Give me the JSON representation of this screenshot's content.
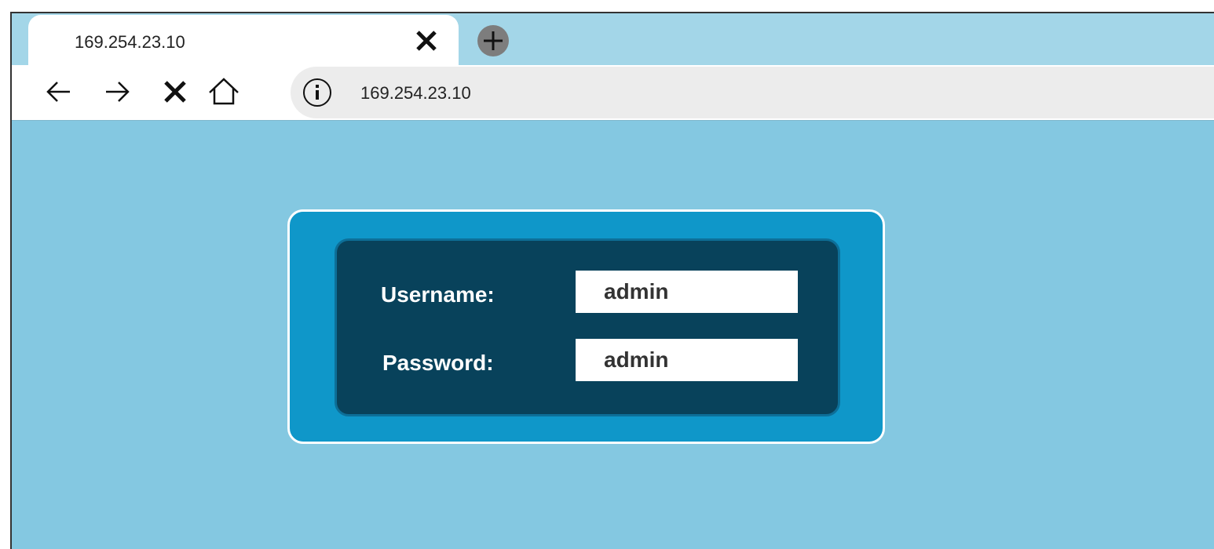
{
  "browser": {
    "tab": {
      "title": "169.254.23.10"
    },
    "address_bar": {
      "url": "169.254.23.10"
    },
    "icons": {
      "back": "arrow-left-icon",
      "forward": "arrow-right-icon",
      "stop": "close-icon",
      "home": "home-icon",
      "info": "info-icon",
      "new_tab": "plus-icon",
      "close_tab": "close-icon"
    }
  },
  "login": {
    "username_label": "Username:",
    "username_value": "admin",
    "password_label": "Password:",
    "password_value": "admin"
  },
  "colors": {
    "page_background": "#84c8e1",
    "tab_strip": "#a3d6e8",
    "panel_outer": "#0f97c9",
    "panel_inner": "#08425b"
  }
}
